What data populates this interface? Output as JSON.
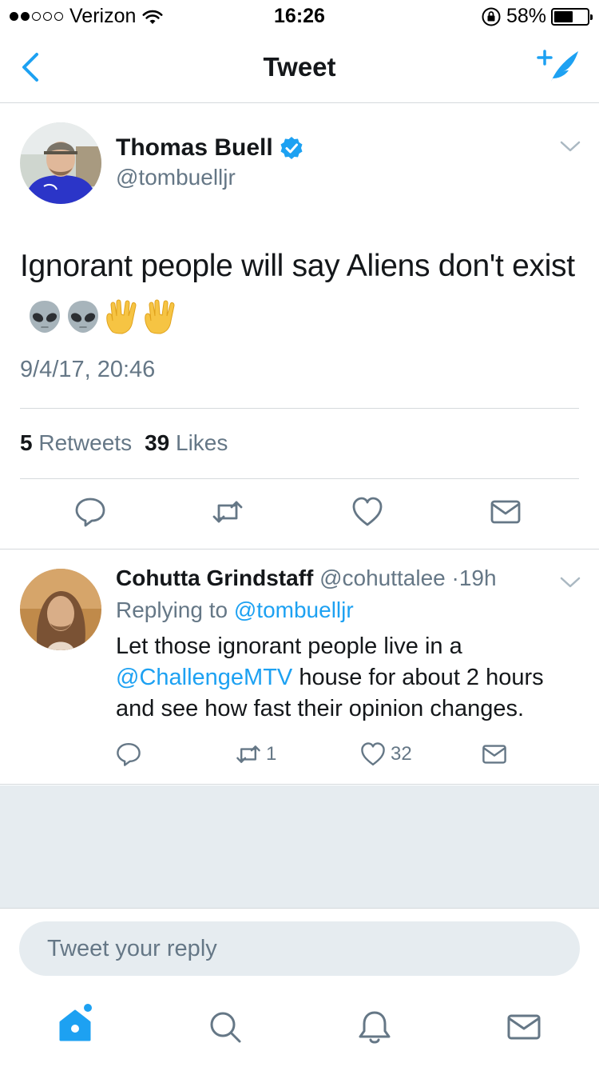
{
  "status_bar": {
    "carrier": "Verizon",
    "time": "16:26",
    "battery": "58%",
    "battery_level": 0.58
  },
  "nav": {
    "title": "Tweet",
    "back_icon": "chevron-left-icon",
    "compose_icon": "compose-tweet-icon"
  },
  "tweet": {
    "author_name": "Thomas Buell",
    "author_handle": "@tombuelljr",
    "verified": true,
    "text": "Ignorant people will say Aliens don't exist",
    "emojis": [
      "alien-emoji",
      "alien-emoji",
      "vulcan-salute-emoji",
      "vulcan-salute-emoji"
    ],
    "timestamp": "9/4/17, 20:46",
    "retweets_count": "5",
    "retweets_label": "Retweets",
    "likes_count": "39",
    "likes_label": "Likes"
  },
  "reply": {
    "author_name": "Cohutta Grindstaff",
    "author_handle": "@cohuttalee",
    "separator": "·",
    "time": "19h",
    "replying_to_label": "Replying to",
    "replying_to_handle": "@tombuelljr",
    "text_part1": "Let those ignorant people live in a",
    "text_mention": "@ChallengeMTV",
    "text_part2": "house for about 2 hours and see how fast their opinion changes.",
    "retweets_count": "1",
    "likes_count": "32"
  },
  "reply_bar": {
    "placeholder": "Tweet your reply"
  },
  "colors": {
    "accent": "#1da1f2",
    "secondary_text": "#657786",
    "primary_text": "#14171a",
    "background_grey": "#e6ecf0"
  }
}
